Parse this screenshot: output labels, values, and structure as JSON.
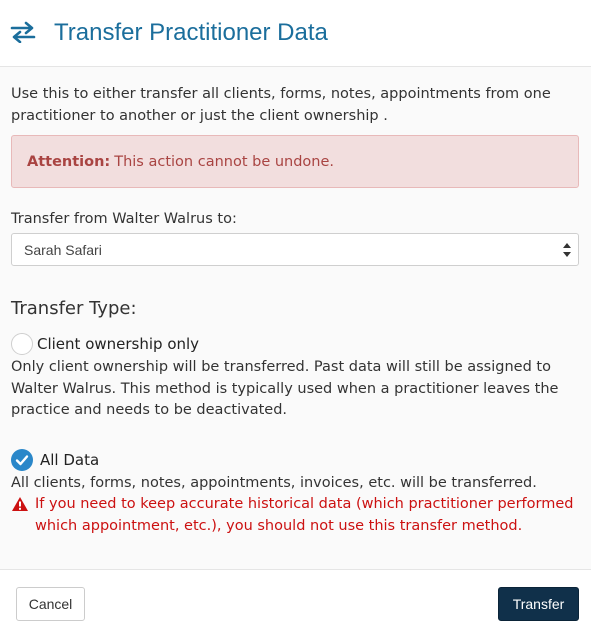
{
  "header": {
    "title": "Transfer Practitioner Data",
    "icon": "transfer-arrows-icon",
    "accent_color": "#1b6e9c"
  },
  "intro": "Use this to either transfer all clients, forms, notes, appointments from one practitioner to another or just the client ownership .",
  "alert": {
    "label": "Attention:",
    "message": "This action cannot be undone."
  },
  "transfer_from": {
    "label": "Transfer from Walter Walrus to:",
    "selected": "Sarah Safari"
  },
  "transfer_type": {
    "heading": "Transfer Type:",
    "options": [
      {
        "label": "Client ownership only",
        "selected": false,
        "description": "Only client ownership will be transferred. Past data will still be assigned to Walter Walrus. This method is typically used when a practitioner leaves the practice and needs to be deactivated."
      },
      {
        "label": "All Data",
        "selected": true,
        "description": "All clients, forms, notes, appointments, invoices, etc. will be transferred.",
        "warning": "If you need to keep accurate historical data (which practitioner performed which appointment, etc.), you should not use this transfer method."
      }
    ]
  },
  "footer": {
    "cancel_label": "Cancel",
    "transfer_label": "Transfer"
  }
}
